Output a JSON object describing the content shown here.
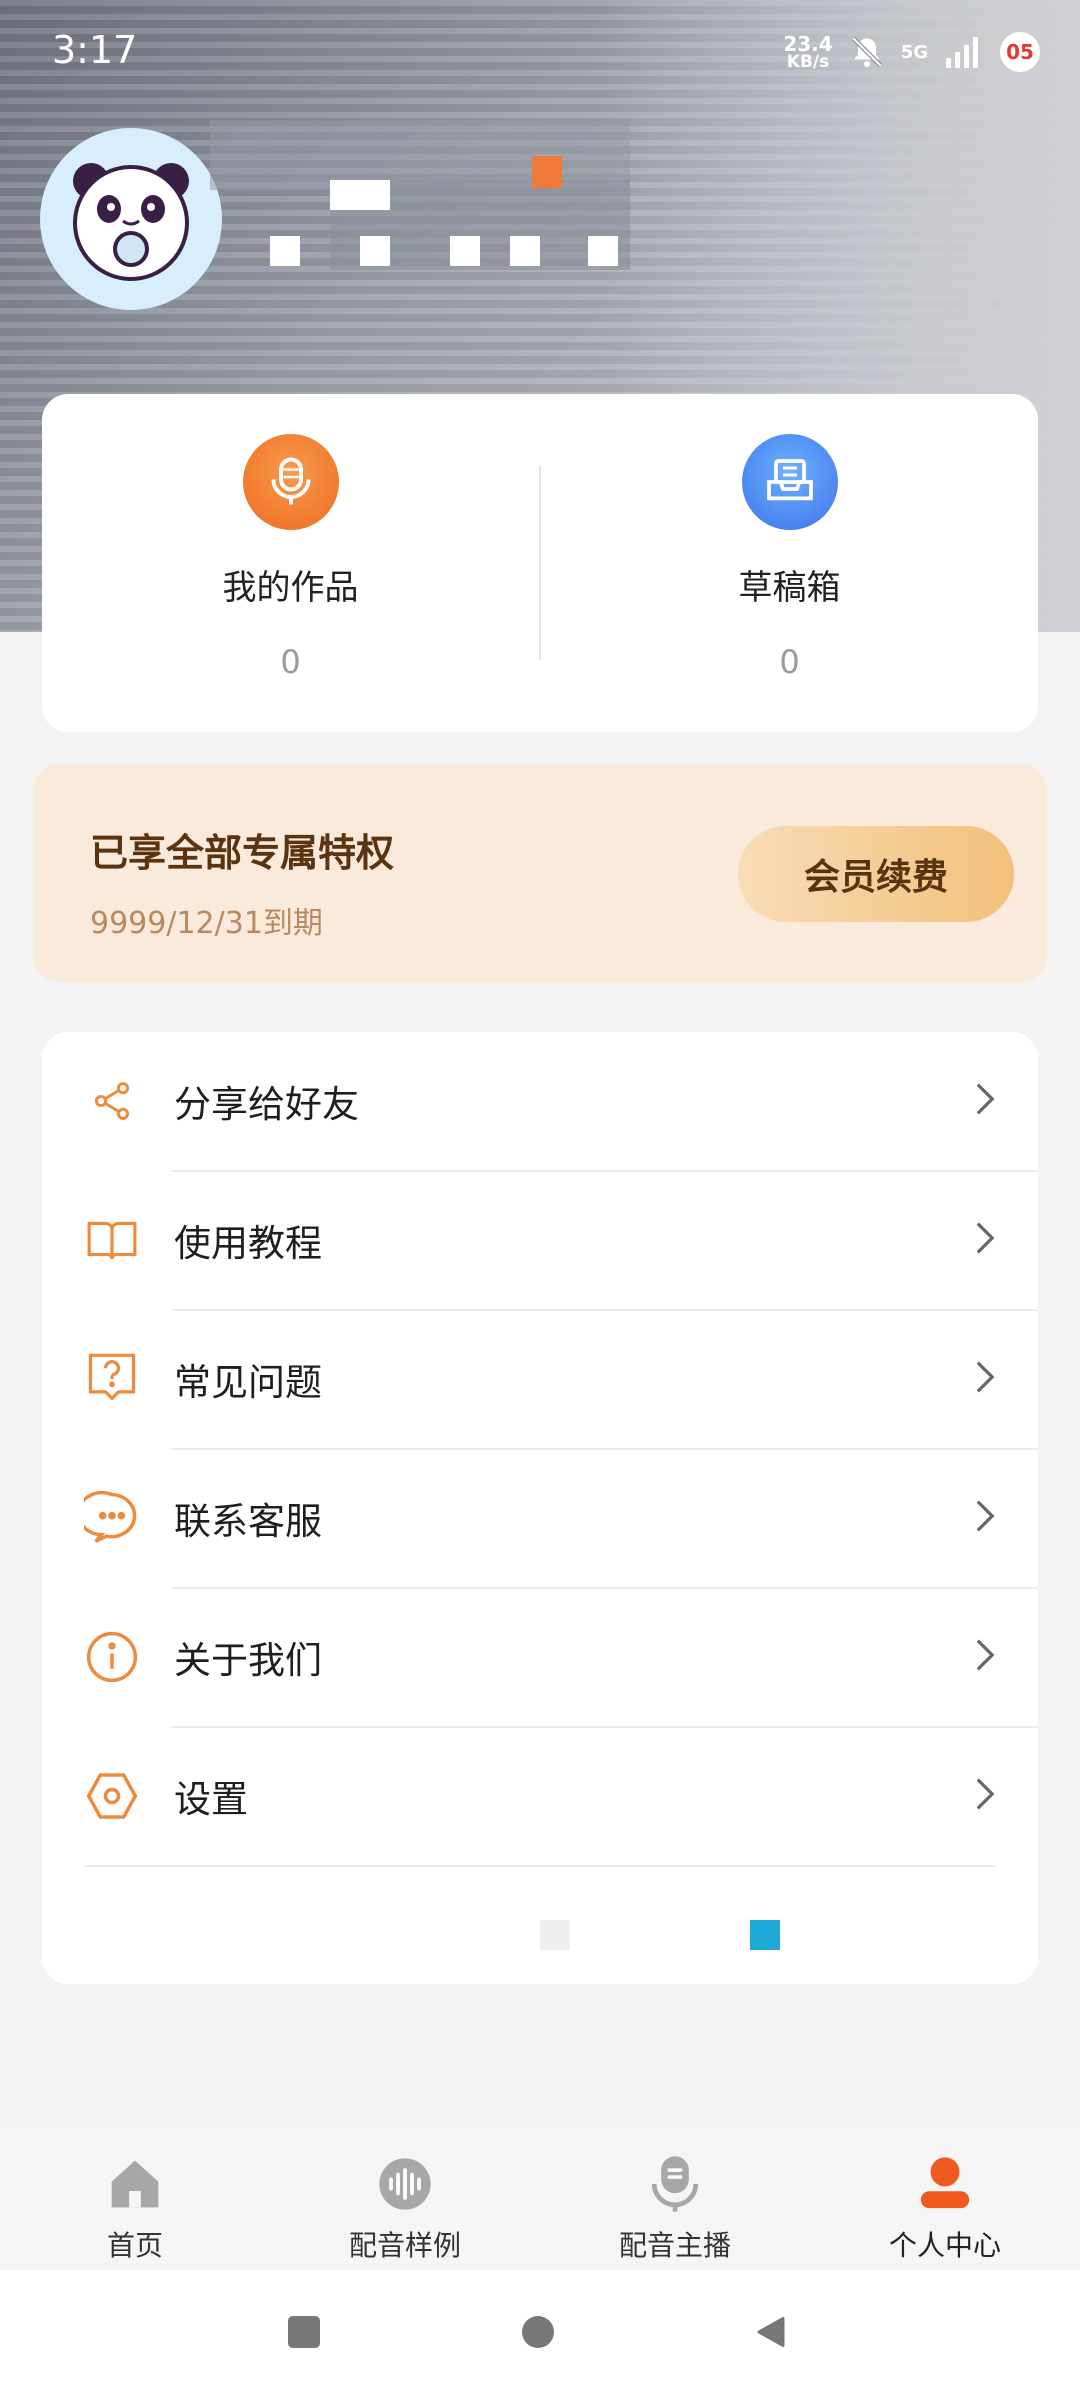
{
  "status_bar": {
    "time": "3:17",
    "net_speed_value": "23.4",
    "net_speed_unit": "KB/s",
    "network_type": "5G",
    "battery_level": "05"
  },
  "works": {
    "items": [
      {
        "label": "我的作品",
        "count": "0",
        "icon": "microphone-icon",
        "color": "#f37b2d"
      },
      {
        "label": "草稿箱",
        "count": "0",
        "icon": "inbox-icon",
        "color": "#3d7ff1"
      }
    ]
  },
  "vip": {
    "title": "已享全部专属特权",
    "expire": "9999/12/31到期",
    "button_label": "会员续费"
  },
  "menu": {
    "items": [
      {
        "label": "分享给好友",
        "icon": "share-icon"
      },
      {
        "label": "使用教程",
        "icon": "book-icon"
      },
      {
        "label": "常见问题",
        "icon": "question-icon"
      },
      {
        "label": "联系客服",
        "icon": "chat-icon"
      },
      {
        "label": "关于我们",
        "icon": "info-icon"
      },
      {
        "label": "设置",
        "icon": "settings-icon"
      }
    ],
    "accent_color": "#ef8a3c"
  },
  "bottom_nav": {
    "items": [
      {
        "label": "首页",
        "icon": "home-icon",
        "active": false
      },
      {
        "label": "配音样例",
        "icon": "soundwave-icon",
        "active": false
      },
      {
        "label": "配音主播",
        "icon": "host-mic-icon",
        "active": false
      },
      {
        "label": "个人中心",
        "icon": "person-icon",
        "active": true
      }
    ],
    "active_color": "#f05a1e",
    "inactive_color": "#a7a7a7"
  }
}
